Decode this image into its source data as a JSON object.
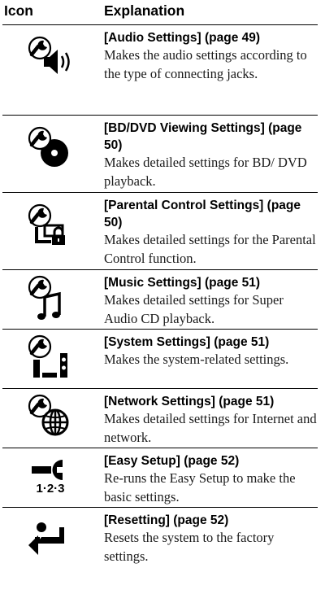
{
  "header": {
    "icon_col": "Icon",
    "explanation_col": "Explanation"
  },
  "rows": [
    {
      "icon": "audio-settings-icon",
      "title": "[Audio Settings] (page 49)",
      "description": "Makes the audio settings according to the type of connecting jacks."
    },
    {
      "icon": "bd-dvd-settings-icon",
      "title": "[BD/DVD Viewing Settings] (page 50)",
      "description": "Makes detailed settings for BD/ DVD playback."
    },
    {
      "icon": "parental-control-icon",
      "title": "[Parental Control Settings] (page 50)",
      "description": "Makes detailed settings for the Parental Control function."
    },
    {
      "icon": "music-settings-icon",
      "title": "[Music Settings] (page 51)",
      "description": "Makes detailed settings for Super Audio CD playback."
    },
    {
      "icon": "system-settings-icon",
      "title": "[System Settings] (page 51)",
      "description": "Makes the system-related settings."
    },
    {
      "icon": "network-settings-icon",
      "title": "[Network Settings] (page 51)",
      "description": "Makes detailed settings for Internet and network."
    },
    {
      "icon": "easy-setup-icon",
      "icon_text": "1·2·3",
      "title": "[Easy Setup] (page 52)",
      "description": "Re-runs the Easy Setup to make the basic settings."
    },
    {
      "icon": "resetting-icon",
      "title": "[Resetting] (page 52)",
      "description": "Resets the system to the factory settings."
    }
  ]
}
